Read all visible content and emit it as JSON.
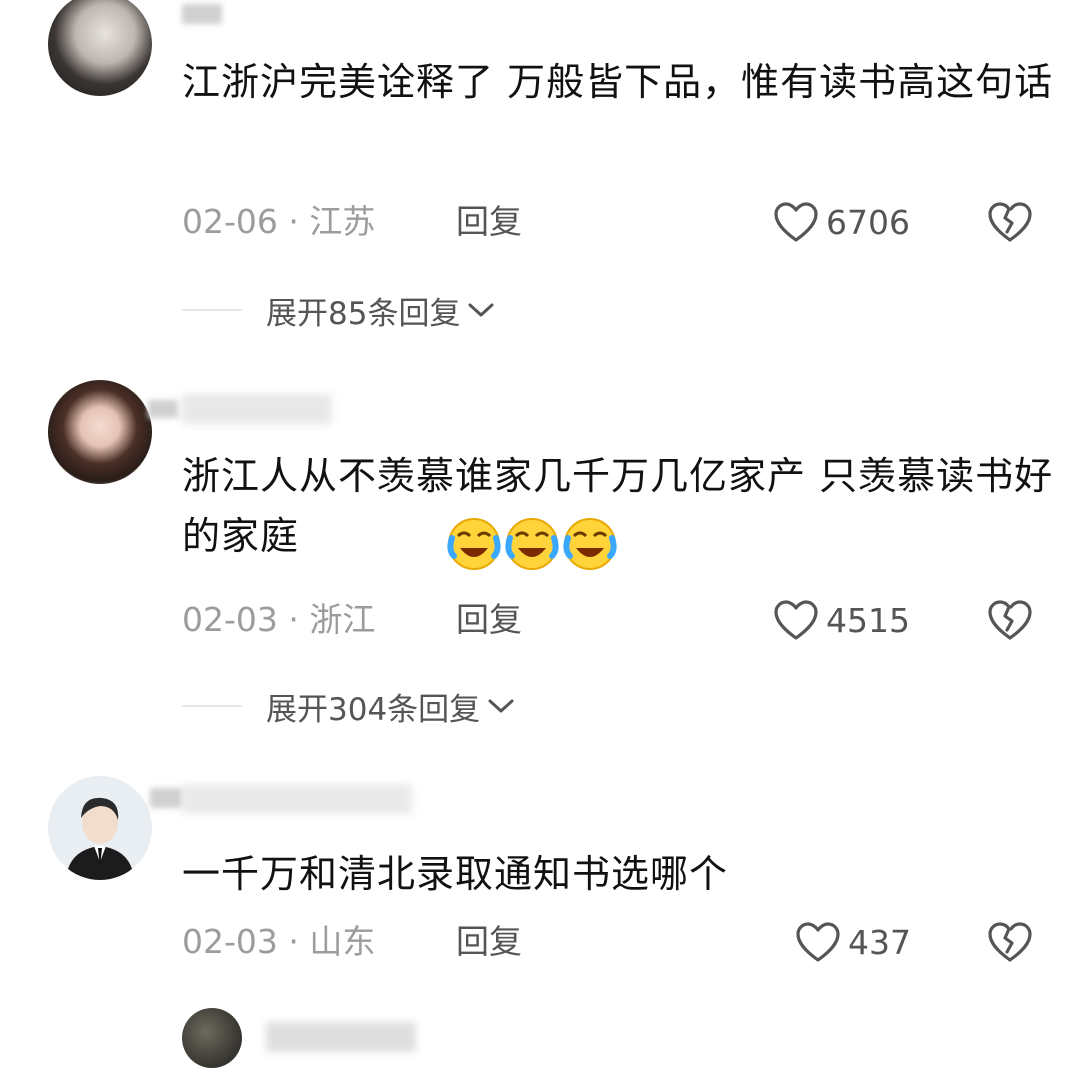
{
  "comments": [
    {
      "username": "",
      "text": "江浙沪完美诠释了  万般皆下品，惟有读书高这句话",
      "date": "02-06",
      "location": "江苏",
      "reply_label": "回复",
      "likes": "6706",
      "expand_label": "展开85条回复"
    },
    {
      "username": "",
      "text": "浙江人从不羡慕谁家几千万几亿家产 只羡慕读书好的家庭",
      "date": "02-03",
      "location": "浙江",
      "reply_label": "回复",
      "likes": "4515",
      "expand_label": "展开304条回复"
    },
    {
      "username": "",
      "text": "一千万和清北录取通知书选哪个",
      "date": "02-03",
      "location": "山东",
      "reply_label": "回复",
      "likes": "437"
    },
    {
      "username": ""
    }
  ],
  "separator": "·",
  "icons": {
    "like": "heart-outline-icon",
    "dislike": "broken-heart-icon",
    "expand": "chevron-down-icon",
    "emoji": "crying-laughing-emoji"
  },
  "colors": {
    "text": "#111111",
    "meta": "#9c9c9c",
    "action": "#555555"
  }
}
